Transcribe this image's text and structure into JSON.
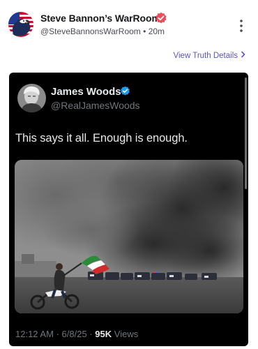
{
  "post": {
    "author": "Steve Bannon’s WarRoom",
    "handle": "@SteveBannonsWarRoom",
    "separator": "•",
    "time": "20m",
    "view_details": "View Truth Details",
    "more_icon": "more-vertical-icon",
    "badge_icon": "verified-badge-icon"
  },
  "embed": {
    "name": "James Woods",
    "handle": "@RealJamesWoods",
    "text": "This says it all. Enough is enough.",
    "time": "12:12 AM",
    "dot": "·",
    "date": "6/8/25",
    "views_count": "95K",
    "views_label": "Views"
  },
  "colors": {
    "link": "#5b53c9",
    "truth_badge": "#e8505b",
    "x_badge": "#1d9bf0",
    "embed_bg": "#000000"
  }
}
